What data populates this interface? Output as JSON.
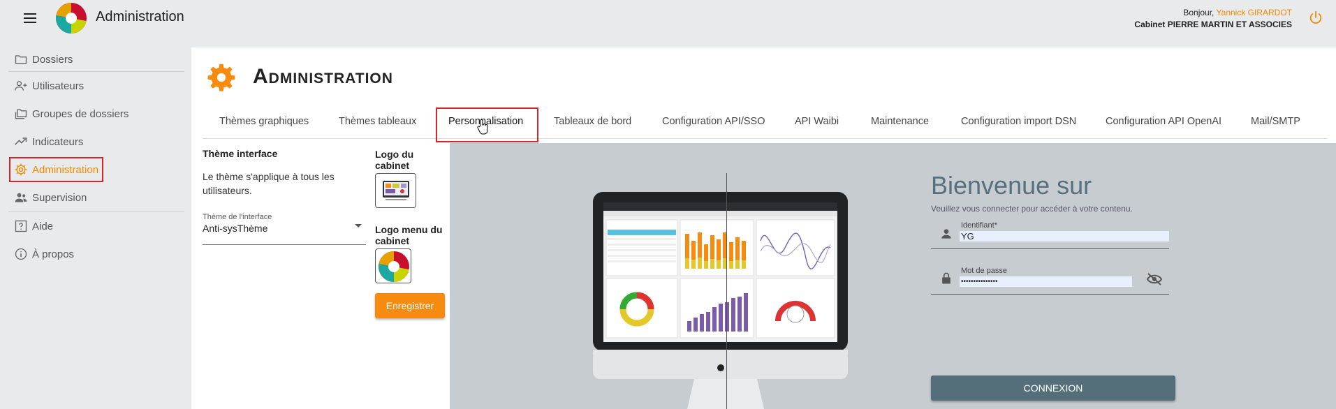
{
  "header": {
    "app_title": "Administration",
    "greeting": "Bonjour,",
    "user_name": "Yannick GIRARDOT",
    "firm": "Cabinet PIERRE MARTIN ET ASSOCIES"
  },
  "sidebar": {
    "items": [
      {
        "label": "Dossiers",
        "icon": "folder-icon"
      },
      {
        "label": "Utilisateurs",
        "icon": "add-user-icon"
      },
      {
        "label": "Groupes de dossiers",
        "icon": "folders-icon"
      },
      {
        "label": "Indicateurs",
        "icon": "trending-up-icon"
      },
      {
        "label": "Administration",
        "icon": "gear-icon",
        "active": true
      },
      {
        "label": "Supervision",
        "icon": "supervisor-icon"
      },
      {
        "label": "Aide",
        "icon": "help-icon"
      },
      {
        "label": "À propos",
        "icon": "info-icon"
      }
    ]
  },
  "page": {
    "title": "Administration"
  },
  "tabs": [
    {
      "label": "Thèmes graphiques"
    },
    {
      "label": "Thèmes tableaux"
    },
    {
      "label": "Personnalisation",
      "active": true
    },
    {
      "label": "Tableaux de bord"
    },
    {
      "label": "Configuration API/SSO"
    },
    {
      "label": "API Waibi"
    },
    {
      "label": "Maintenance"
    },
    {
      "label": "Configuration import DSN"
    },
    {
      "label": "Configuration API OpenAI"
    },
    {
      "label": "Mail/SMTP"
    }
  ],
  "theme": {
    "title": "Thème interface",
    "description": "Le thème s'applique à tous les utilisateurs.",
    "field_label": "Thème de l'interface",
    "field_value": "Anti-sysThème"
  },
  "logos": {
    "cabinet_label": "Logo du cabinet",
    "menu_label": "Logo menu du cabinet",
    "save_button": "Enregistrer"
  },
  "preview": {
    "welcome": "Bienvenue sur",
    "subtitle": "Veuillez vous connecter pour accéder à votre contenu.",
    "id_label": "Identifiant*",
    "id_value": "YG",
    "pwd_label": "Mot de passe",
    "pwd_value": "•••••••••••••••",
    "connect_button": "CONNEXION"
  },
  "colors": {
    "accent": "#f08a00",
    "highlight_box": "#d9252a",
    "login_button": "#546e7a",
    "preview_bg": "#c7ccd1"
  }
}
